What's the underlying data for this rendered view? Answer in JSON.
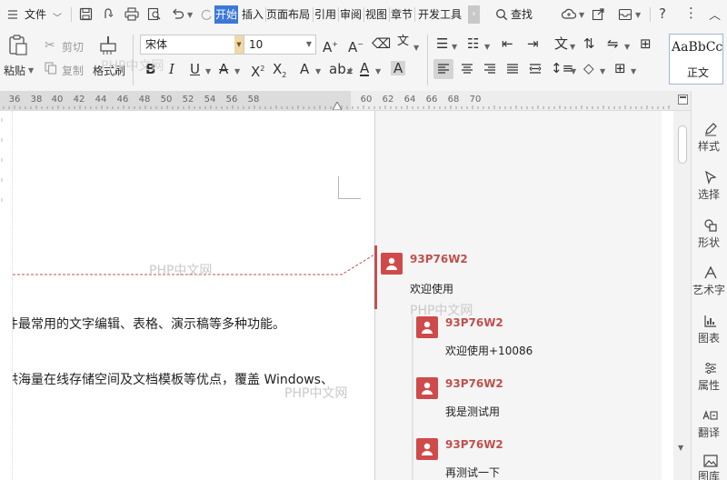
{
  "menu": {
    "file": "文件",
    "tabs": [
      "开始",
      "插入",
      "页面布局",
      "引用",
      "审阅",
      "视图",
      "章节",
      "开发工具"
    ],
    "search": "查找"
  },
  "ribbon": {
    "paste": "粘贴",
    "cut": "剪切",
    "copy": "复制",
    "format_painter": "格式刷",
    "font_name": "宋体",
    "font_size": "10",
    "style_preview": "AaBbCc",
    "style_name": "正文"
  },
  "ruler": {
    "ticks": [
      "36",
      "38",
      "40",
      "42",
      "44",
      "46",
      "48",
      "50",
      "52",
      "54",
      "56",
      "58",
      "60",
      "62",
      "64",
      "66",
      "68",
      "70"
    ]
  },
  "document": {
    "line1": "件最常用的文字编辑、表格、演示稿等多种功能。",
    "line2": "供海量在线存储空间及文档模板等优点，覆盖 Windows、",
    "watermarks": [
      "PHP中文网",
      "PHP中文网",
      "PHP中文网",
      "PHP中文网"
    ]
  },
  "comments": [
    {
      "author": "93P76W2",
      "text": "欢迎使用"
    },
    {
      "author": "93P76W2",
      "text": "欢迎使用+10086"
    },
    {
      "author": "93P76W2",
      "text": "我是测试用"
    },
    {
      "author": "93P76W2",
      "text": "再测试一下"
    }
  ],
  "task_panel": {
    "items": [
      "样式",
      "选择",
      "形状",
      "艺术字",
      "图表",
      "属性",
      "翻译",
      "图库"
    ]
  },
  "colors": {
    "active_tab": "#3c78d8",
    "comment_author": "#c0504d",
    "avatar": "#cf4b4b",
    "revision_line": "#c0504d"
  }
}
